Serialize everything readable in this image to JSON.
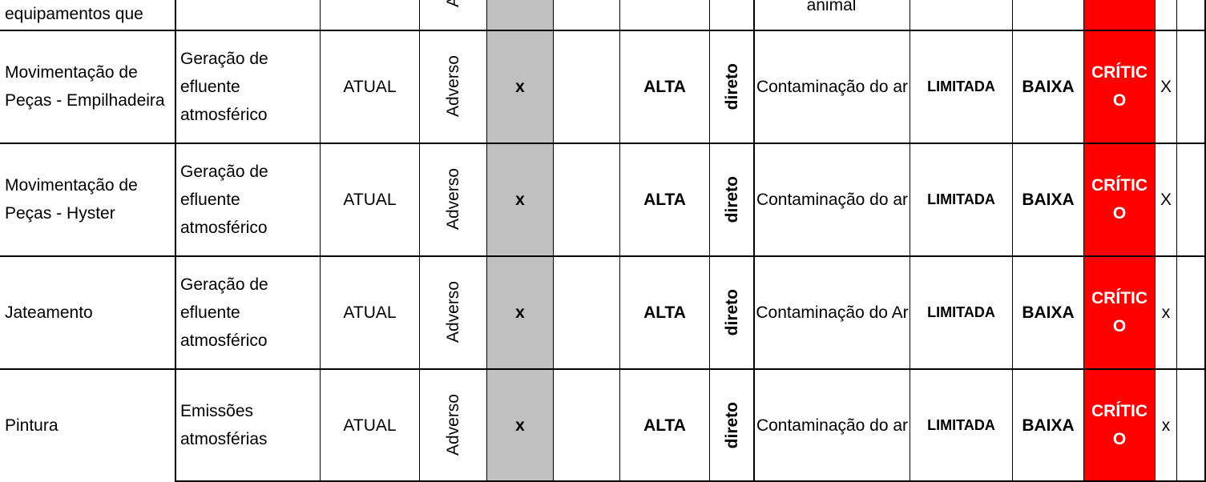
{
  "colors": {
    "critical_bg": "#ff0000",
    "critical_text": "#ffffff",
    "shaded_column": "#c0c0c0",
    "grid": "#000000"
  },
  "partial_top_row": {
    "activity": "equipamentos que",
    "adverse_fragment": "A",
    "impact": "animal"
  },
  "rows": [
    {
      "activity": "Movimentação de Peças - Empilhadeira",
      "aspect": "Geração de efluente atmosférico",
      "temporality": "ATUAL",
      "nature": "Adverso",
      "mark": "x",
      "frequency": "ALTA",
      "incidence": "direto",
      "impact": "Contaminação do ar",
      "scope": "LIMITADA",
      "severity": "BAIXA",
      "significance": "CRÍTICO",
      "check": "X"
    },
    {
      "activity": "Movimentação de Peças - Hyster",
      "aspect": "Geração de efluente atmosférico",
      "temporality": "ATUAL",
      "nature": "Adverso",
      "mark": "x",
      "frequency": "ALTA",
      "incidence": "direto",
      "impact": "Contaminação do ar",
      "scope": "LIMITADA",
      "severity": "BAIXA",
      "significance": "CRÍTICO",
      "check": "X"
    },
    {
      "activity": "Jateamento",
      "aspect": "Geração de efluente atmosférico",
      "temporality": "ATUAL",
      "nature": "Adverso",
      "mark": "x",
      "frequency": "ALTA",
      "incidence": "direto",
      "impact": "Contaminação do Ar",
      "scope": "LIMITADA",
      "severity": "BAIXA",
      "significance": "CRÍTICO",
      "check": "x"
    },
    {
      "activity": "Pintura",
      "aspect": "Emissões atmosférias",
      "temporality": "ATUAL",
      "nature": "Adverso",
      "mark": "x",
      "frequency": "ALTA",
      "incidence": "direto",
      "impact": "Contaminação do ar",
      "scope": "LIMITADA",
      "severity": "BAIXA",
      "significance": "CRÍTICO",
      "check": "x"
    }
  ]
}
